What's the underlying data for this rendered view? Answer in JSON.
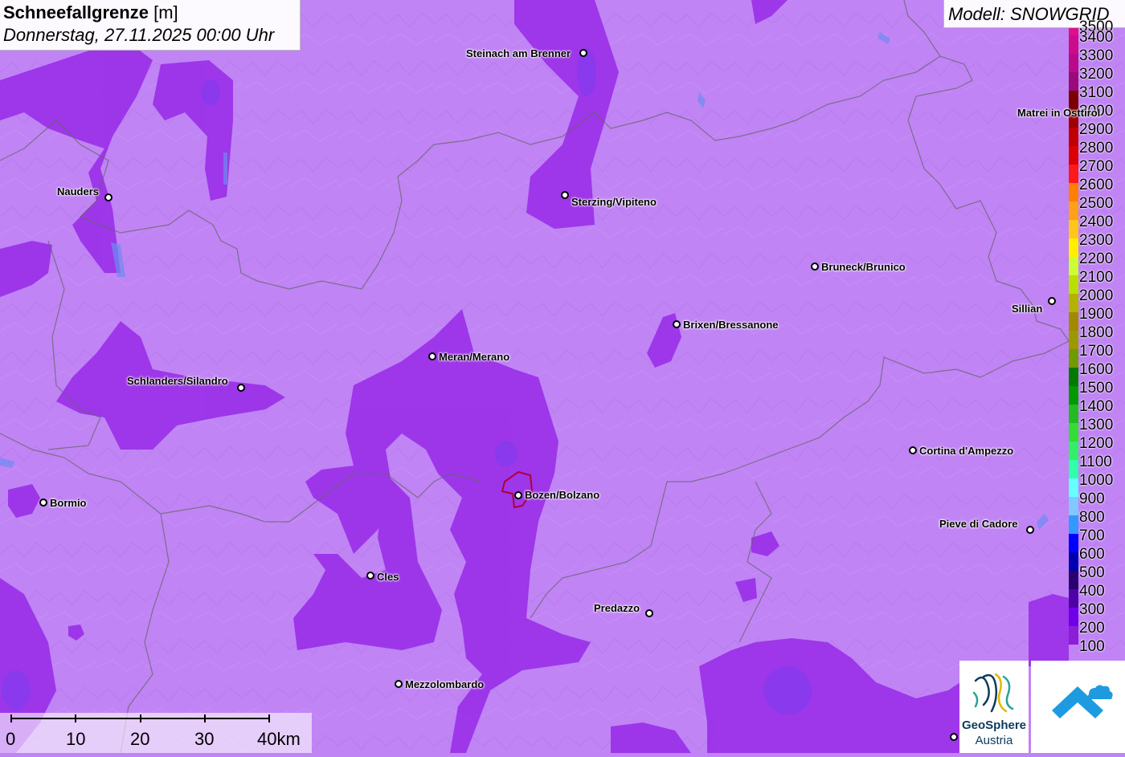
{
  "title": {
    "variable": "Schneefallgrenze",
    "unit": "[m]",
    "datetime": "Donnerstag, 27.11.2025 00:00 Uhr"
  },
  "model": {
    "label": "Modell: SNOWGRID"
  },
  "legend": {
    "top_label": "3500",
    "levels": [
      {
        "label": "3400",
        "color": "#cc0c8a"
      },
      {
        "label": "3300",
        "color": "#b80b8a"
      },
      {
        "label": "3200",
        "color": "#9a0a78"
      },
      {
        "label": "3100",
        "color": "#7a0000"
      },
      {
        "label": "3000",
        "color": "#a00000"
      },
      {
        "label": "2900",
        "color": "#c00000"
      },
      {
        "label": "2800",
        "color": "#dc0000"
      },
      {
        "label": "2700",
        "color": "#ff1a1a"
      },
      {
        "label": "2600",
        "color": "#ff7f00"
      },
      {
        "label": "2500",
        "color": "#ff9f1a"
      },
      {
        "label": "2400",
        "color": "#ffc61a"
      },
      {
        "label": "2300",
        "color": "#ffee00"
      },
      {
        "label": "2200",
        "color": "#ccff33"
      },
      {
        "label": "2100",
        "color": "#b8e000"
      },
      {
        "label": "2000",
        "color": "#b3b300"
      },
      {
        "label": "1900",
        "color": "#a08a00"
      },
      {
        "label": "1800",
        "color": "#9a9a00"
      },
      {
        "label": "1700",
        "color": "#6f9a00"
      },
      {
        "label": "1600",
        "color": "#007a00"
      },
      {
        "label": "1500",
        "color": "#009900"
      },
      {
        "label": "1400",
        "color": "#22bb22"
      },
      {
        "label": "1300",
        "color": "#33dd33"
      },
      {
        "label": "1200",
        "color": "#33ee66"
      },
      {
        "label": "1100",
        "color": "#33ffaa"
      },
      {
        "label": "1000",
        "color": "#66ffff"
      },
      {
        "label": "900",
        "color": "#80c8ff"
      },
      {
        "label": "800",
        "color": "#3399ff"
      },
      {
        "label": "700",
        "color": "#0000ff"
      },
      {
        "label": "600",
        "color": "#0000b0"
      },
      {
        "label": "500",
        "color": "#2a0070"
      },
      {
        "label": "400",
        "color": "#5000a8"
      },
      {
        "label": "300",
        "color": "#7000e8"
      },
      {
        "label": "200",
        "color": "#8c1ed8"
      },
      {
        "label": "100",
        "color": "#c084f5"
      }
    ]
  },
  "cities": [
    {
      "name": "Steinach am Brenner"
    },
    {
      "name": "Sterzing/Vipiteno"
    },
    {
      "name": "Nauders"
    },
    {
      "name": "Bruneck/Brunico"
    },
    {
      "name": "Sillian"
    },
    {
      "name": "Brixen/Bressanone"
    },
    {
      "name": "Meran/Merano"
    },
    {
      "name": "Schlanders/Silandro"
    },
    {
      "name": "Cortina d'Ampezzo"
    },
    {
      "name": "Bormio"
    },
    {
      "name": "Bozen/Bolzano"
    },
    {
      "name": "Pieve di Cadore"
    },
    {
      "name": "Cles"
    },
    {
      "name": "Predazzo"
    },
    {
      "name": "Mezzolombardo"
    },
    {
      "name": "Matrei in Osttirol"
    }
  ],
  "scale_bar": {
    "labels": [
      "0",
      "10",
      "20",
      "30",
      "40km"
    ]
  },
  "logos": {
    "geosphere_line1": "GeoSphere",
    "geosphere_line2": "Austria"
  },
  "colors": {
    "light_violet": "#c084f5",
    "dark_violet": "#9a2ee8",
    "border": "#666666",
    "bolzano_outline": "#b0003a"
  }
}
